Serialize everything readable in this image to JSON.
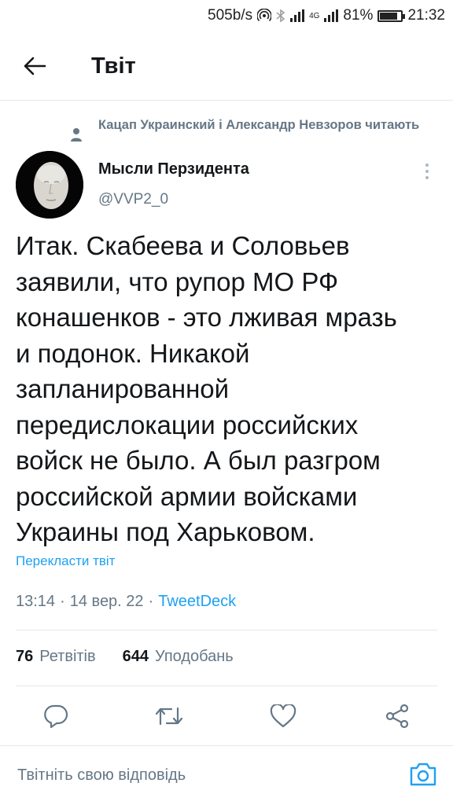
{
  "status_bar": {
    "speed": "505b/s",
    "network": "4G",
    "battery": "81%",
    "battery_level": 0.81,
    "time": "21:32"
  },
  "header": {
    "title": "Твіт",
    "back_icon": "arrow-left-icon"
  },
  "tweet": {
    "social_context": "Кацап Украинский і Александр Невзоров читають",
    "author_name": "Мысли Перзидента",
    "author_handle": "@VVP2_0",
    "text_lines": [
      "Итак. Скабеева и Соловьев",
      "заявили, что рупор МО РФ",
      "конашенков - это лживая мразь",
      "и подонок. Никакой",
      "запланированной",
      "передислокации российских",
      "войск не было. А был разгром",
      "российской армии войсками",
      "Украины под Харьковом."
    ],
    "translate_label": "Перекласти твіт",
    "time": "13:14",
    "date": "14 вер. 22",
    "separator": "·",
    "source": "TweetDeck",
    "retweets_count": "76",
    "retweets_label": "Ретвітів",
    "likes_count": "644",
    "likes_label": "Уподобань"
  },
  "actions": {
    "reply_icon": "reply-icon",
    "retweet_icon": "retweet-icon",
    "like_icon": "heart-icon",
    "share_icon": "share-icon"
  },
  "reply_bar": {
    "placeholder": "Твітніть свою відповідь",
    "camera_icon": "camera-icon"
  },
  "colors": {
    "accent": "#1da1f2",
    "secondary_text": "#657786",
    "primary_text": "#14171a",
    "divider": "#e1e8ed"
  }
}
